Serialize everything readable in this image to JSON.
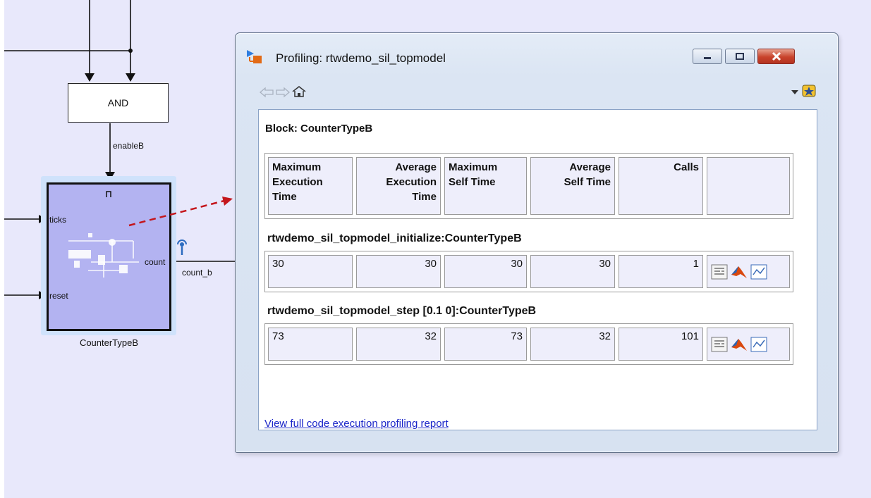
{
  "model": {
    "and_block_label": "AND",
    "enable_signal_label": "enableB",
    "subsystem": {
      "name": "CounterTypeB",
      "trigger_symbol": "⎍",
      "inports": [
        "ticks",
        "reset"
      ],
      "outport": "count"
    },
    "output_signal_label": "count_b"
  },
  "window": {
    "title": "Profiling: rtwdemo_sil_topmodel",
    "block_heading": "Block: CounterTypeB",
    "columns": [
      "Maximum Execution Time",
      "Average Execution Time",
      "Maximum Self Time",
      "Average Self Time",
      "Calls"
    ],
    "sections": [
      {
        "title": "rtwdemo_sil_topmodel_initialize:CounterTypeB",
        "values": [
          "30",
          "30",
          "30",
          "30",
          "1"
        ]
      },
      {
        "title": "rtwdemo_sil_topmodel_step [0.1 0]:CounterTypeB",
        "values": [
          "73",
          "32",
          "73",
          "32",
          "101"
        ]
      }
    ],
    "link_text": "View full code execution profiling report"
  },
  "colors": {
    "canvas": "#e8e8fb",
    "subsystem_fill": "#b3b3f1",
    "arrow": "#c4161c",
    "link": "#1a25c8"
  },
  "icons": [
    "back-arrow-icon",
    "forward-arrow-icon",
    "home-icon",
    "dropdown-icon",
    "favorites-icon",
    "code-icon",
    "matlab-icon",
    "plot-icon"
  ]
}
